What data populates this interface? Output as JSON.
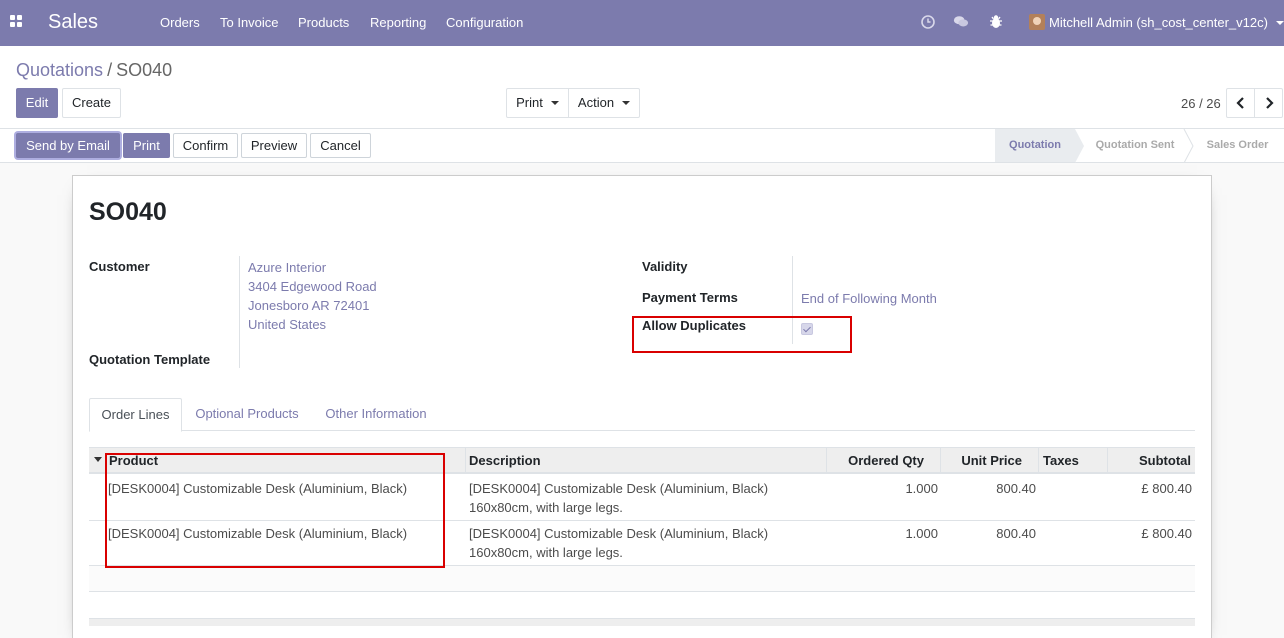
{
  "navbar": {
    "brand": "Sales",
    "menu": [
      "Orders",
      "To Invoice",
      "Products",
      "Reporting",
      "Configuration"
    ],
    "user": "Mitchell Admin (sh_cost_center_v12c)",
    "icons": [
      "apps-icon",
      "clock-icon",
      "chat-icon",
      "bug-icon"
    ]
  },
  "breadcrumb": {
    "parent": "Quotations",
    "separator": "/",
    "current": "SO040"
  },
  "toolbar": {
    "edit": "Edit",
    "create": "Create",
    "print": "Print",
    "action": "Action",
    "pager": "26 / 26"
  },
  "statusbar": {
    "buttons": [
      "Send by Email",
      "Print",
      "Confirm",
      "Preview",
      "Cancel"
    ],
    "stages": [
      "Quotation",
      "Quotation Sent",
      "Sales Order"
    ],
    "active_stage": "Quotation"
  },
  "form": {
    "title": "SO040",
    "customer_label": "Customer",
    "customer_lines": [
      "Azure Interior",
      "3404 Edgewood Road",
      "Jonesboro AR 72401",
      "United States"
    ],
    "template_label": "Quotation Template",
    "validity_label": "Validity",
    "payment_terms_label": "Payment Terms",
    "payment_terms_value": "End of Following Month",
    "allow_duplicates_label": "Allow Duplicates",
    "allow_duplicates_checked": true
  },
  "tabs": [
    "Order Lines",
    "Optional Products",
    "Other Information"
  ],
  "table": {
    "headers": [
      "Product",
      "Description",
      "Ordered Qty",
      "Unit Price",
      "Taxes",
      "Subtotal"
    ],
    "rows": [
      {
        "product": "[DESK0004] Customizable Desk (Aluminium, Black)",
        "description_1": "[DESK0004] Customizable Desk (Aluminium, Black)",
        "description_2": "160x80cm, with large legs.",
        "qty": "1.000",
        "unit_price": "800.40",
        "taxes": "",
        "subtotal": "£ 800.40"
      },
      {
        "product": "[DESK0004] Customizable Desk (Aluminium, Black)",
        "description_1": "[DESK0004] Customizable Desk (Aluminium, Black)",
        "description_2": "160x80cm, with large legs.",
        "qty": "1.000",
        "unit_price": "800.40",
        "taxes": "",
        "subtotal": "£ 800.40"
      }
    ]
  },
  "colors": {
    "brand": "#7c7bad",
    "highlight": "#d90000"
  }
}
